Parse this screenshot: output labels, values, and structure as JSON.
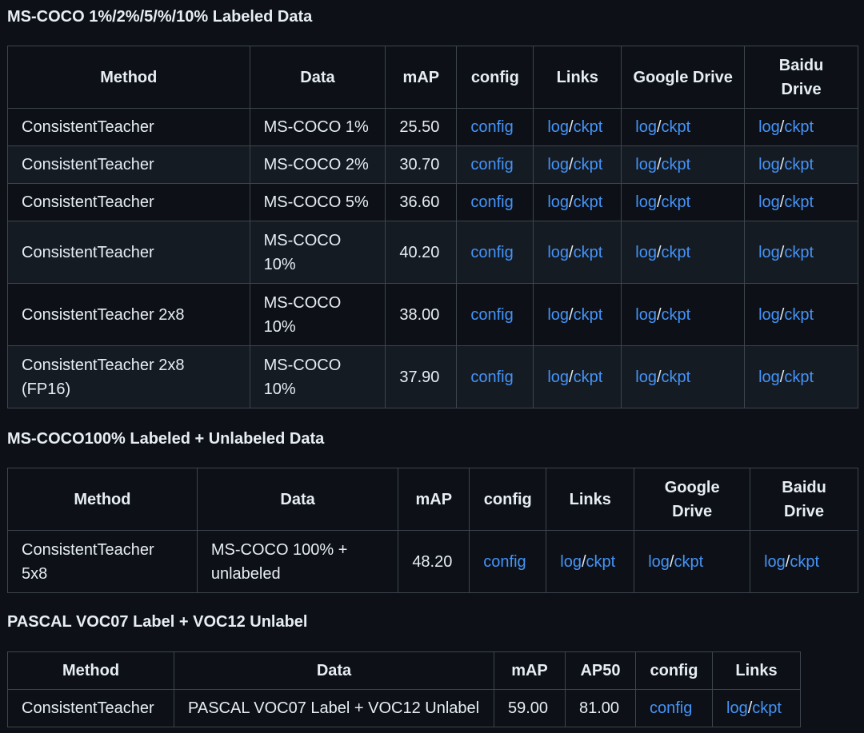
{
  "section1": {
    "title": "MS-COCO 1%/2%/5/%/10% Labeled Data",
    "headers": [
      "Method",
      "Data",
      "mAP",
      "config",
      "Links",
      "Google Drive",
      "Baidu Drive"
    ],
    "rows": [
      {
        "method": "ConsistentTeacher",
        "data": "MS-COCO 1%",
        "map": "25.50"
      },
      {
        "method": "ConsistentTeacher",
        "data": "MS-COCO 2%",
        "map": "30.70"
      },
      {
        "method": "ConsistentTeacher",
        "data": "MS-COCO 5%",
        "map": "36.60"
      },
      {
        "method": "ConsistentTeacher",
        "data": "MS-COCO 10%",
        "map": "40.20"
      },
      {
        "method": "ConsistentTeacher 2x8",
        "data": "MS-COCO 10%",
        "map": "38.00"
      },
      {
        "method": "ConsistentTeacher 2x8 (FP16)",
        "data": "MS-COCO 10%",
        "map": "37.90"
      }
    ]
  },
  "section2": {
    "title": "MS-COCO100% Labeled + Unlabeled Data",
    "headers": [
      "Method",
      "Data",
      "mAP",
      "config",
      "Links",
      "Google Drive",
      "Baidu Drive"
    ],
    "rows": [
      {
        "method": "ConsistentTeacher 5x8",
        "data": "MS-COCO 100% + unlabeled",
        "map": "48.20"
      }
    ]
  },
  "section3": {
    "title": "PASCAL VOC07 Label + VOC12 Unlabel",
    "headers": [
      "Method",
      "Data",
      "mAP",
      "AP50",
      "config",
      "Links"
    ],
    "rows": [
      {
        "method": "ConsistentTeacher",
        "data": "PASCAL VOC07 Label + VOC12 Unlabel",
        "map": "59.00",
        "ap50": "81.00"
      }
    ]
  },
  "links": {
    "config": "config",
    "log": "log",
    "ckpt": "ckpt",
    "separator": "/"
  },
  "colors": {
    "background": "#0d1117",
    "text": "#e6edf3",
    "link": "#4493f8",
    "border": "#3d444d",
    "stripe": "#151b23"
  }
}
